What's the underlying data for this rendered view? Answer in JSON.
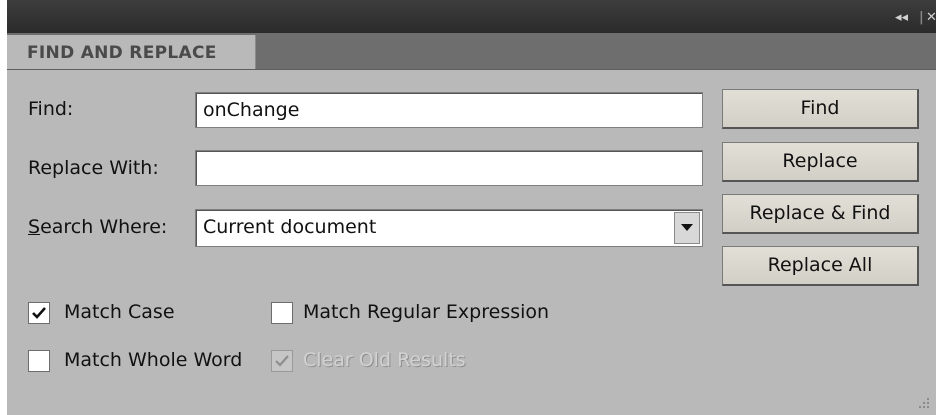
{
  "titlebar": {
    "collapse_glyph": "◂◂",
    "close_glyph": "✕"
  },
  "tab": {
    "label": "FIND AND REPLACE"
  },
  "find": {
    "label": "Find:",
    "value": "onChange"
  },
  "replace": {
    "label": "Replace With:",
    "value": ""
  },
  "search_where": {
    "label": "Search Where:",
    "value": "Current document"
  },
  "buttons": {
    "find": "Find",
    "replace": "Replace",
    "replace_find": "Replace & Find",
    "replace_all": "Replace All"
  },
  "options": {
    "match_case": {
      "label": "Match Case",
      "checked": true,
      "enabled": true
    },
    "match_regex": {
      "label": "Match Regular Expression",
      "checked": false,
      "enabled": true
    },
    "match_whole_word": {
      "label": "Match Whole Word",
      "checked": false,
      "enabled": true
    },
    "clear_old_results": {
      "label": "Clear Old Results",
      "checked": true,
      "enabled": false
    }
  },
  "icons": {
    "dropdown": "triangle-down-icon",
    "check": "checkmark-icon",
    "collapse": "double-chevron-left-icon",
    "close": "close-icon",
    "resize": "resize-grip-icon"
  },
  "colors": {
    "panel": "#b9b9b9",
    "titlebar": "#333333",
    "tabstrip": "#6e6e6e",
    "button": "#dcd9d1"
  }
}
